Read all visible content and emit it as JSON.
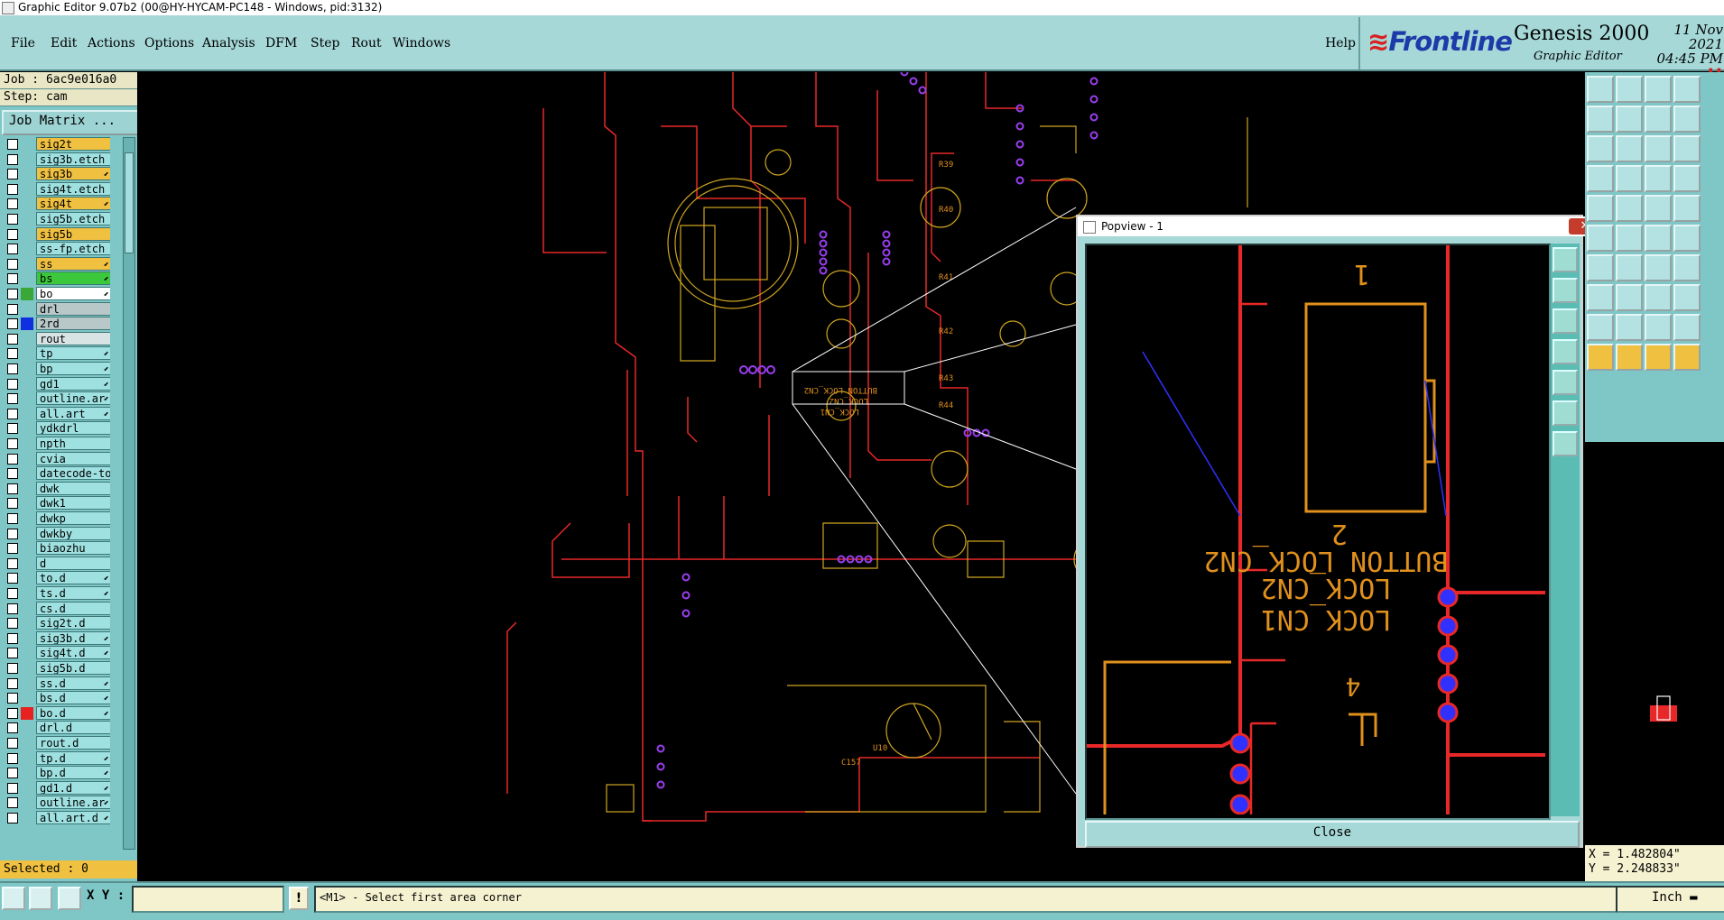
{
  "window": {
    "title": "Graphic Editor 9.07b2 (00@HY-HYCAM-PC148 - Windows, pid:3132)"
  },
  "menu": {
    "items": [
      "File",
      "Edit",
      "Actions",
      "Options",
      "Analysis",
      "DFM",
      "Step",
      "Rout",
      "Windows"
    ],
    "help": "Help"
  },
  "brand": {
    "logo": "Frontline",
    "product": "Genesis 2000",
    "subtitle": "Graphic Editor",
    "date": "11 Nov 2021",
    "time": "04:45 PM"
  },
  "job": {
    "job_label": "Job : 6ac9e016a0",
    "step_label": "Step: cam",
    "matrix_button": "Job Matrix ..."
  },
  "layers": [
    {
      "name": "sig2t",
      "style": "orange",
      "color": "",
      "arrow": false
    },
    {
      "name": "sig3b.etch",
      "style": "cyan",
      "color": "",
      "arrow": false
    },
    {
      "name": "sig3b",
      "style": "orange",
      "color": "",
      "arrow": true
    },
    {
      "name": "sig4t.etch",
      "style": "cyan",
      "color": "",
      "arrow": false
    },
    {
      "name": "sig4t",
      "style": "orange",
      "color": "",
      "arrow": true
    },
    {
      "name": "sig5b.etch",
      "style": "cyan",
      "color": "",
      "arrow": false
    },
    {
      "name": "sig5b",
      "style": "orange",
      "color": "",
      "arrow": false
    },
    {
      "name": "ss-fp.etch",
      "style": "cyan",
      "color": "",
      "arrow": false
    },
    {
      "name": "ss",
      "style": "orange",
      "color": "",
      "arrow": true
    },
    {
      "name": "bs",
      "style": "green",
      "color": "",
      "arrow": true
    },
    {
      "name": "bo",
      "style": "white",
      "color": "#3aa838",
      "arrow": true
    },
    {
      "name": "drl",
      "style": "gray",
      "color": "",
      "arrow": false
    },
    {
      "name": "2rd",
      "style": "gray",
      "color": "#1030e0",
      "arrow": false
    },
    {
      "name": "rout",
      "style": "lgray",
      "color": "",
      "arrow": false
    },
    {
      "name": "tp",
      "style": "cyan",
      "color": "",
      "arrow": true
    },
    {
      "name": "bp",
      "style": "cyan",
      "color": "",
      "arrow": true
    },
    {
      "name": "gd1",
      "style": "cyan",
      "color": "",
      "arrow": true
    },
    {
      "name": "outline.ar",
      "style": "cyan",
      "color": "",
      "arrow": true
    },
    {
      "name": "all.art",
      "style": "cyan",
      "color": "",
      "arrow": true
    },
    {
      "name": "ydkdrl",
      "style": "cyan",
      "color": "",
      "arrow": false
    },
    {
      "name": "npth",
      "style": "cyan",
      "color": "",
      "arrow": false
    },
    {
      "name": "cvia",
      "style": "cyan",
      "color": "",
      "arrow": false
    },
    {
      "name": "datecode-to",
      "style": "cyan",
      "color": "",
      "arrow": false
    },
    {
      "name": "dwk",
      "style": "cyan",
      "color": "",
      "arrow": false
    },
    {
      "name": "dwk1",
      "style": "cyan",
      "color": "",
      "arrow": false
    },
    {
      "name": "dwkp",
      "style": "cyan",
      "color": "",
      "arrow": false
    },
    {
      "name": "dwkby",
      "style": "cyan",
      "color": "",
      "arrow": false
    },
    {
      "name": "biaozhu",
      "style": "cyan",
      "color": "",
      "arrow": false
    },
    {
      "name": "d",
      "style": "cyan",
      "color": "",
      "arrow": false
    },
    {
      "name": "to.d",
      "style": "cyan",
      "color": "",
      "arrow": true
    },
    {
      "name": "ts.d",
      "style": "cyan",
      "color": "",
      "arrow": true
    },
    {
      "name": "cs.d",
      "style": "cyan",
      "color": "",
      "arrow": false
    },
    {
      "name": "sig2t.d",
      "style": "cyan",
      "color": "",
      "arrow": false
    },
    {
      "name": "sig3b.d",
      "style": "cyan",
      "color": "",
      "arrow": true
    },
    {
      "name": "sig4t.d",
      "style": "cyan",
      "color": "",
      "arrow": true
    },
    {
      "name": "sig5b.d",
      "style": "cyan",
      "color": "",
      "arrow": false
    },
    {
      "name": "ss.d",
      "style": "cyan",
      "color": "",
      "arrow": true
    },
    {
      "name": "bs.d",
      "style": "cyan",
      "color": "",
      "arrow": true
    },
    {
      "name": "bo.d",
      "style": "cyan",
      "color": "#e82020",
      "arrow": true
    },
    {
      "name": "drl.d",
      "style": "cyan",
      "color": "",
      "arrow": false
    },
    {
      "name": "rout.d",
      "style": "cyan",
      "color": "",
      "arrow": false
    },
    {
      "name": "tp.d",
      "style": "cyan",
      "color": "",
      "arrow": true
    },
    {
      "name": "bp.d",
      "style": "cyan",
      "color": "",
      "arrow": true
    },
    {
      "name": "gd1.d",
      "style": "cyan",
      "color": "",
      "arrow": true
    },
    {
      "name": "outline.ar",
      "style": "cyan",
      "color": "",
      "arrow": true
    },
    {
      "name": "all.art.d",
      "style": "cyan",
      "color": "",
      "arrow": true
    }
  ],
  "selected_label": "Selected : 0",
  "popview": {
    "title": "Popview - 1",
    "close_button": "Close",
    "texts": [
      "1",
      "2",
      "BUTTON LOCK_CN2",
      "LOCK_CN2",
      "LOCK_CN1",
      "4"
    ]
  },
  "canvas_texts": [
    "BUTTON LOCK_CN2",
    "LOCK_CN2",
    "LOCK_CN1",
    "U10",
    "C157",
    "R39",
    "R40",
    "R41",
    "R42",
    "R43",
    "R44"
  ],
  "coords": {
    "x": "X = 1.482804\"",
    "y": "Y = 2.248833\""
  },
  "bottom": {
    "xy_label": "X Y :",
    "xy_value": "",
    "exclaim": "!",
    "status": "<M1> - Select first area corner",
    "units": "Inch"
  },
  "colors": {
    "panel": "#7fc6c6",
    "menubar": "#a6d8d8",
    "trace_red": "#e82828",
    "trace_orange": "#e0901c",
    "pad_violet": "#9a3ef0",
    "pad_blue": "#3030ff"
  },
  "icons": [
    "window-icon",
    "close-icon",
    "select-arrow-icon",
    "zoom-icon",
    "fit-icon",
    "ruler-icon",
    "measure-icon",
    "snap-icon",
    "home-icon"
  ]
}
